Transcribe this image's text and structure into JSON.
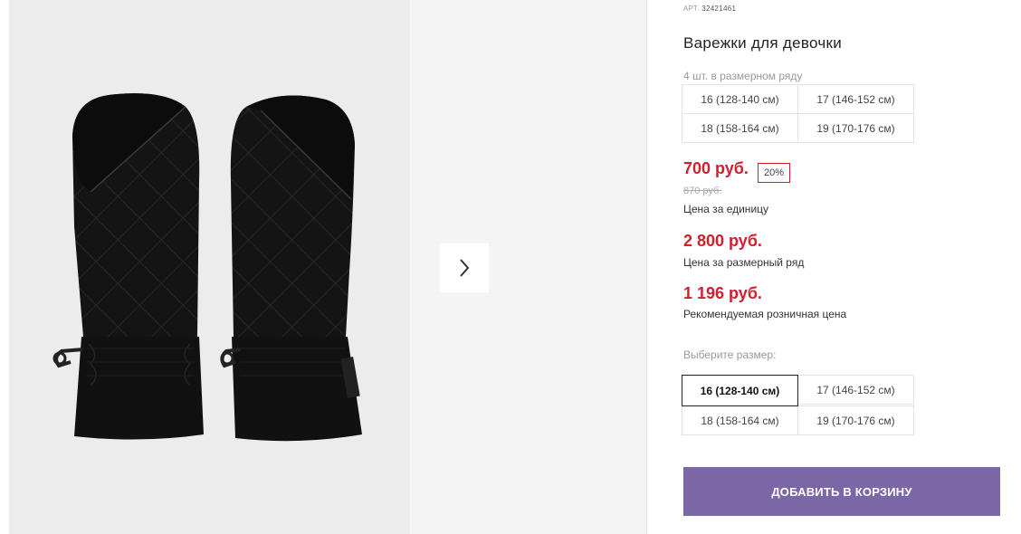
{
  "product": {
    "art_label": "АРТ.",
    "art_number": "32421461",
    "title": "Варежки для девочки",
    "pack_note": "4 шт. в размерном ряду"
  },
  "pack_sizes": [
    "16 (128-140 см)",
    "17 (146-152 см)",
    "18 (158-164 см)",
    "19 (170-176 см)"
  ],
  "pricing": {
    "unit_price": "700 руб.",
    "discount": "20%",
    "old_price": "870 руб.",
    "unit_label": "Цена за единицу",
    "row_price": "2 800 руб.",
    "row_label": "Цена за размерный ряд",
    "rrp_price": "1 196 руб.",
    "rrp_label": "Рекомендуемая розничная цена"
  },
  "size_select": {
    "label": "Выберите размер:",
    "options": [
      "16 (128-140 см)",
      "17 (146-152 см)",
      "18 (158-164 см)",
      "19 (170-176 см)"
    ],
    "selected": "16 (128-140 см)"
  },
  "actions": {
    "add_to_cart": "ДОБАВИТЬ В КОРЗИНУ"
  },
  "gallery": {
    "next_icon": "chevron-right-icon"
  },
  "colors": {
    "price_red": "#d0202e",
    "button_purple": "#7b67a6"
  }
}
